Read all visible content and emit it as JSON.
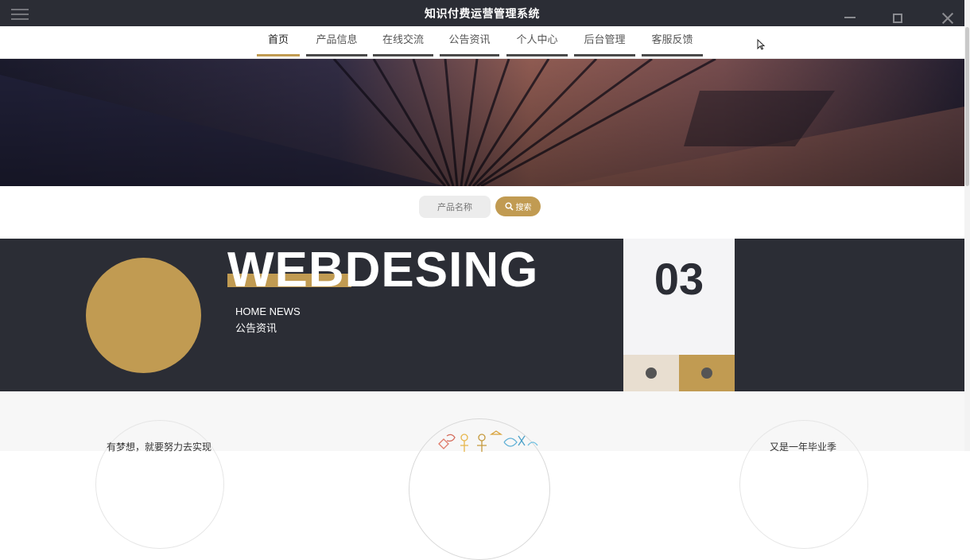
{
  "window": {
    "title": "知识付费运营管理系统"
  },
  "nav": {
    "items": [
      {
        "label": "首页",
        "active": true
      },
      {
        "label": "产品信息"
      },
      {
        "label": "在线交流"
      },
      {
        "label": "公告资讯"
      },
      {
        "label": "个人中心"
      },
      {
        "label": "后台管理"
      },
      {
        "label": "客服反馈"
      }
    ]
  },
  "search": {
    "placeholder": "产品名称",
    "button_label": "搜索",
    "icon": "search-icon"
  },
  "banner": {
    "big_word": "WEBDESING",
    "subtitle_en": "HOME NEWS",
    "subtitle_cn": "公告资讯",
    "counter": "03"
  },
  "bottom": {
    "left_caption": "有梦想，就要努力去实现",
    "right_caption": "又是一年毕业季"
  },
  "colors": {
    "accent": "#c19b52",
    "dark": "#2b2d35",
    "light_panel": "#f4f4f6"
  }
}
